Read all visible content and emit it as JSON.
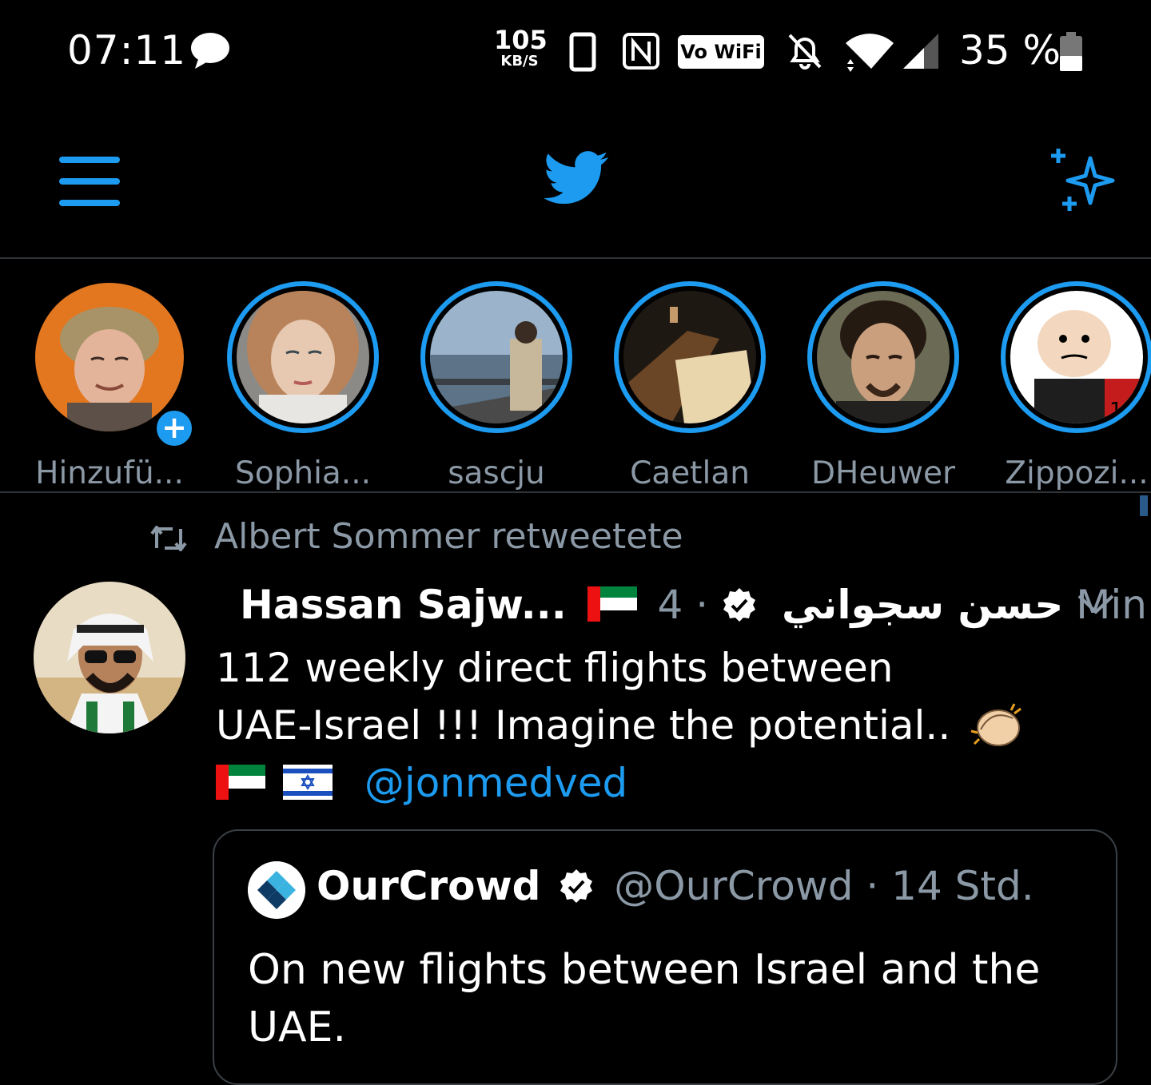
{
  "status_bar": {
    "time": "07:11",
    "net_speed_value": "105",
    "net_speed_unit": "KB/S",
    "vowifi_label": "Vo WiFi",
    "battery_percent": "35 %",
    "icons": [
      "chat-bubble-icon",
      "phone-icon",
      "nfc-icon",
      "vowifi-icon",
      "bell-off-icon",
      "wifi-icon",
      "signal-icon",
      "battery-icon"
    ]
  },
  "app_bar": {
    "icons": [
      "menu-icon",
      "twitter-logo",
      "sparkle-icon"
    ],
    "accent_color": "#1d9bf0"
  },
  "fleets": [
    {
      "name": "Hinzufü...",
      "has_add_badge": true,
      "add_label": "+"
    },
    {
      "name": "Sophia..."
    },
    {
      "name": "sascju"
    },
    {
      "name": "Caetlan"
    },
    {
      "name": "DHeuwer"
    },
    {
      "name": "Zippozi..."
    }
  ],
  "tweet": {
    "retweet_label": "Albert Sommer retweetete",
    "display_name": "Hassan Sajw...",
    "arabic_name": "حسن سجواني",
    "meta": "· 4 Min.",
    "text_line_1": "112 weekly direct flights between",
    "text_line_2": "UAE-Israel !!! Imagine the potential..",
    "mention": "@jonmedved"
  },
  "quoted_tweet": {
    "display_name": "OurCrowd",
    "handle_time": "@OurCrowd · 14 Std.",
    "text": "On new flights between Israel and the UAE."
  }
}
